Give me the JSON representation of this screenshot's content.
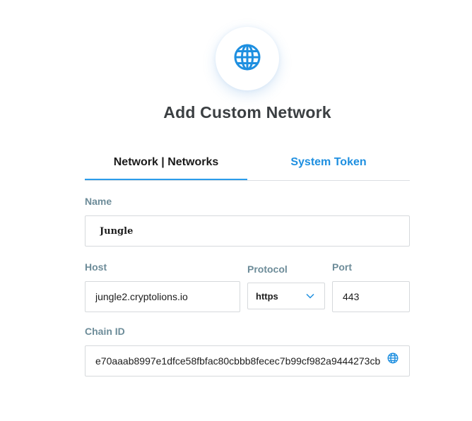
{
  "header": {
    "icon": "globe-icon",
    "title": "Add Custom Network",
    "accent_color": "#1e8fe0"
  },
  "tabs": [
    {
      "label": "Network | Networks",
      "active": true
    },
    {
      "label": "System Token",
      "active": false
    }
  ],
  "form": {
    "name": {
      "label": "Name",
      "value": "Jungle"
    },
    "host": {
      "label": "Host",
      "value": "jungle2.cryptolions.io"
    },
    "protocol": {
      "label": "Protocol",
      "value": "https",
      "icon": "chevron-down-icon"
    },
    "port": {
      "label": "Port",
      "value": "443"
    },
    "chain_id": {
      "label": "Chain ID",
      "value": "e70aaab8997e1dfce58fbfac80cbbb8fecec7b99cf982a9444273cb",
      "icon": "globe-icon"
    }
  }
}
